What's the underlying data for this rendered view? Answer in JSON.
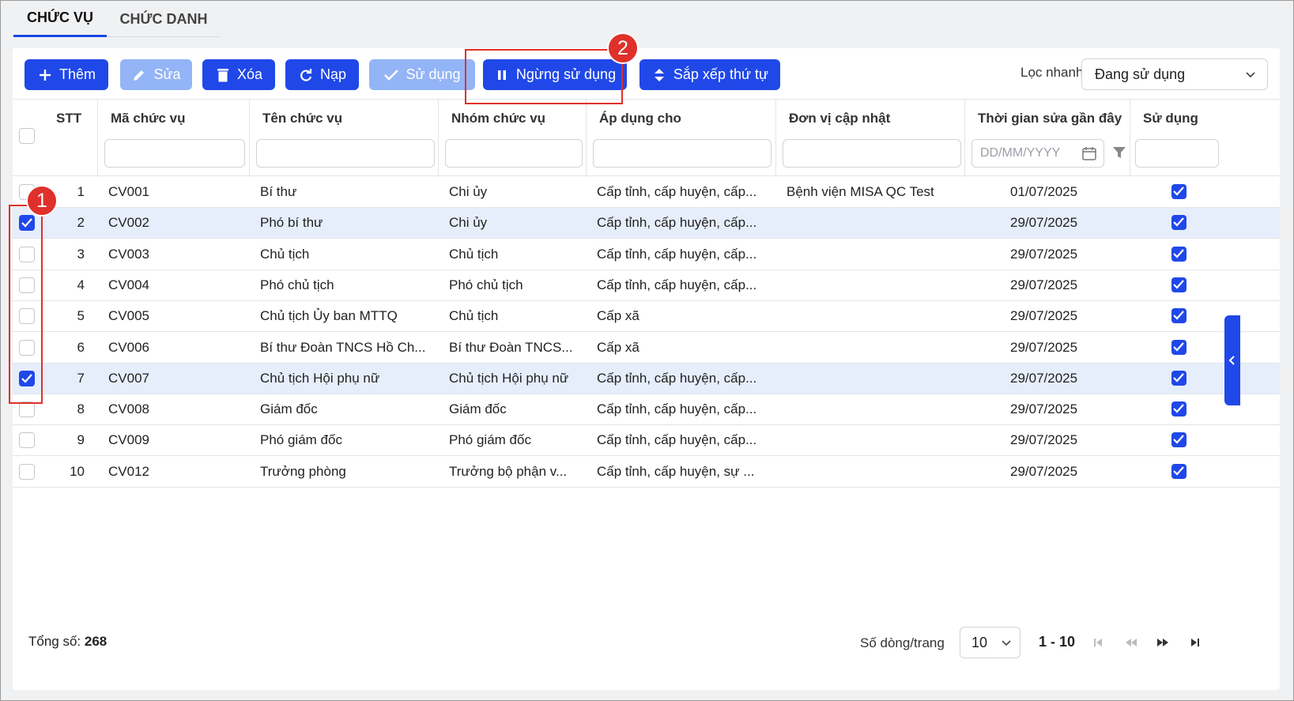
{
  "tabs": [
    {
      "label": "CHỨC VỤ",
      "active": true
    },
    {
      "label": "CHỨC DANH",
      "active": false
    }
  ],
  "toolbar": {
    "add": "Thêm",
    "edit": "Sửa",
    "delete": "Xóa",
    "reload": "Nạp",
    "use": "Sử dụng",
    "stop_use": "Ngừng sử dụng",
    "sort_order": "Sắp xếp thứ tự",
    "quick_filter_label": "Lọc nhanh",
    "quick_filter_value": "Đang sử dụng"
  },
  "annotations": {
    "step1": "1",
    "step2": "2"
  },
  "columns": {
    "stt": "STT",
    "code": "Mã chức vụ",
    "name": "Tên chức vụ",
    "group": "Nhóm chức vụ",
    "apply": "Áp dụng cho",
    "unit": "Đơn vị cập nhật",
    "modified": "Thời gian sửa gần đây",
    "in_use": "Sử dụng",
    "date_placeholder": "DD/MM/YYYY"
  },
  "rows": [
    {
      "stt": "1",
      "code": "CV001",
      "name": "Bí thư",
      "group": "Chi ủy",
      "apply": "Cấp tỉnh, cấp huyện, cấp...",
      "unit": "Bệnh viện MISA QC Test",
      "modified": "01/07/2025",
      "selected": false
    },
    {
      "stt": "2",
      "code": "CV002",
      "name": "Phó bí thư",
      "group": "Chi ủy",
      "apply": "Cấp tỉnh, cấp huyện, cấp...",
      "unit": "",
      "modified": "29/07/2025",
      "selected": true
    },
    {
      "stt": "3",
      "code": "CV003",
      "name": "Chủ tịch",
      "group": "Chủ tịch",
      "apply": "Cấp tỉnh, cấp huyện, cấp...",
      "unit": "",
      "modified": "29/07/2025",
      "selected": false
    },
    {
      "stt": "4",
      "code": "CV004",
      "name": "Phó chủ tịch",
      "group": "Phó chủ tịch",
      "apply": "Cấp tỉnh, cấp huyện, cấp...",
      "unit": "",
      "modified": "29/07/2025",
      "selected": false
    },
    {
      "stt": "5",
      "code": "CV005",
      "name": "Chủ tịch Ủy ban MTTQ",
      "group": "Chủ tịch",
      "apply": "Cấp xã",
      "unit": "",
      "modified": "29/07/2025",
      "selected": false
    },
    {
      "stt": "6",
      "code": "CV006",
      "name": "Bí thư Đoàn TNCS Hồ Ch...",
      "group": "Bí thư Đoàn TNCS...",
      "apply": "Cấp xã",
      "unit": "",
      "modified": "29/07/2025",
      "selected": false
    },
    {
      "stt": "7",
      "code": "CV007",
      "name": "Chủ tịch Hội phụ nữ",
      "group": "Chủ tịch Hội phụ nữ",
      "apply": "Cấp tỉnh, cấp huyện, cấp...",
      "unit": "",
      "modified": "29/07/2025",
      "selected": true
    },
    {
      "stt": "8",
      "code": "CV008",
      "name": "Giám đốc",
      "group": "Giám đốc",
      "apply": "Cấp tỉnh, cấp huyện, cấp...",
      "unit": "",
      "modified": "29/07/2025",
      "selected": false
    },
    {
      "stt": "9",
      "code": "CV009",
      "name": "Phó giám đốc",
      "group": "Phó giám đốc",
      "apply": "Cấp tỉnh, cấp huyện, cấp...",
      "unit": "",
      "modified": "29/07/2025",
      "selected": false
    },
    {
      "stt": "10",
      "code": "CV012",
      "name": "Trưởng phòng",
      "group": "Trưởng bộ phận v...",
      "apply": "Cấp tỉnh, cấp huyện, sự ...",
      "unit": "",
      "modified": "29/07/2025",
      "selected": false
    }
  ],
  "footer": {
    "total_label": "Tổng số:",
    "total_value": "268",
    "per_page_label": "Số dòng/trang",
    "per_page_value": "10",
    "range": "1 - 10"
  },
  "colors": {
    "primary": "#2048e8",
    "primary_disabled": "#93b4f6",
    "highlight": "#e0302b",
    "selected_row": "#e6eefc"
  }
}
